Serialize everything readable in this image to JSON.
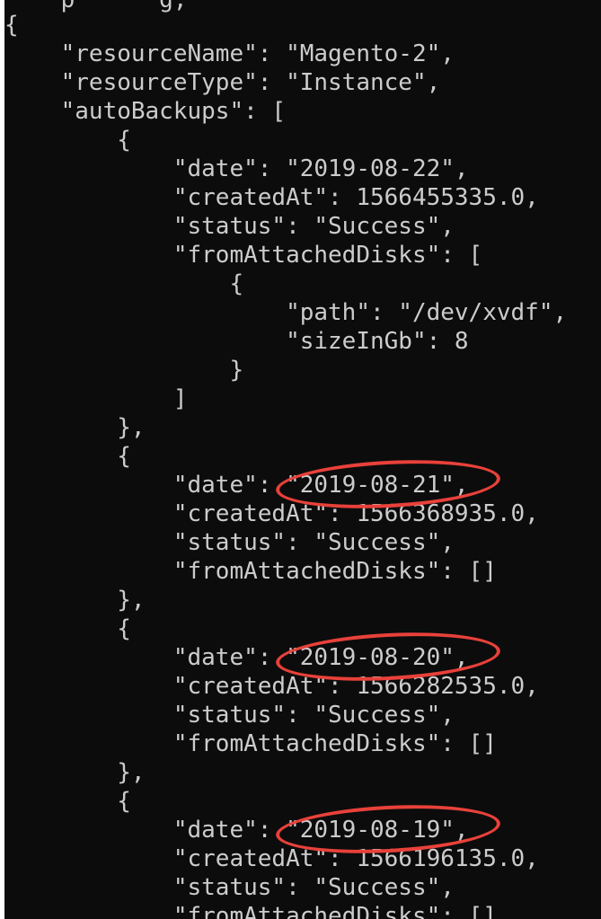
{
  "terminal": {
    "lines": [
      "    p      g,",
      "{",
      "    \"resourceName\": \"Magento-2\",",
      "    \"resourceType\": \"Instance\",",
      "    \"autoBackups\": [",
      "        {",
      "            \"date\": \"2019-08-22\",",
      "            \"createdAt\": 1566455335.0,",
      "            \"status\": \"Success\",",
      "            \"fromAttachedDisks\": [",
      "                {",
      "                    \"path\": \"/dev/xvdf\",",
      "                    \"sizeInGb\": 8",
      "                }",
      "            ]",
      "        },",
      "        {",
      "            \"date\": \"2019-08-21\",",
      "            \"createdAt\": 1566368935.0,",
      "            \"status\": \"Success\",",
      "            \"fromAttachedDisks\": []",
      "        },",
      "        {",
      "            \"date\": \"2019-08-20\",",
      "            \"createdAt\": 1566282535.0,",
      "            \"status\": \"Success\",",
      "            \"fromAttachedDisks\": []",
      "        },",
      "        {",
      "            \"date\": \"2019-08-19\",",
      "            \"createdAt\": 1566196135.0,",
      "            \"status\": \"Success\",",
      "            \"fromAttachedDisks\": []"
    ]
  },
  "annotations": {
    "highlight_color": "#e8413a",
    "highlighted_dates": [
      "2019-08-21",
      "2019-08-20",
      "2019-08-19"
    ]
  }
}
